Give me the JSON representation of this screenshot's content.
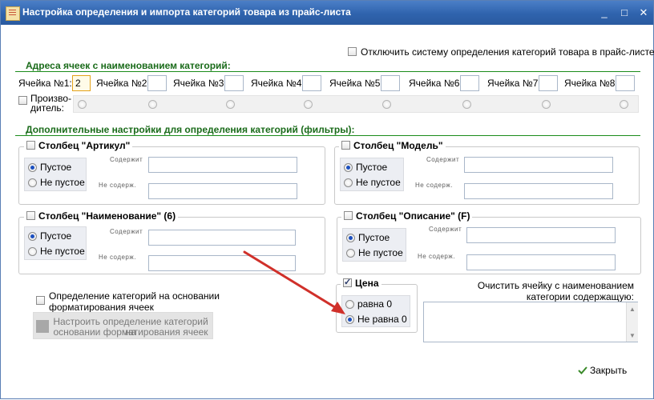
{
  "window": {
    "title": "Настройка определения и импорта категорий товара из прайс-листа",
    "minimize_label": "_",
    "maximize_label": "□",
    "close_label": "✕"
  },
  "top_option": {
    "label": "Отключить систему определения категорий товара в прайс-листе",
    "checked": false
  },
  "cells_section": {
    "title": "Адреса ячеек с наименованием категорий:",
    "cells": [
      {
        "label": "Ячейка №1:",
        "value": "2"
      },
      {
        "label": "Ячейка №2:",
        "value": ""
      },
      {
        "label": "Ячейка №3:",
        "value": ""
      },
      {
        "label": "Ячейка №4:",
        "value": ""
      },
      {
        "label": "Ячейка №5:",
        "value": ""
      },
      {
        "label": "Ячейка №6:",
        "value": ""
      },
      {
        "label": "Ячейка №7:",
        "value": ""
      },
      {
        "label": "Ячейка №8:",
        "value": ""
      }
    ],
    "producer_line1": "Произво-",
    "producer_line2": "дитель:"
  },
  "filters_section": {
    "title": "Дополнительные настройки для определения категорий (фильтры):",
    "contains_label": "Содержит",
    "not_contains_label": "Не содерж.",
    "columns": [
      {
        "title": "Столбец \"Артикул\"",
        "checked": false,
        "opt_empty": "Пустое",
        "opt_not_empty": "Не пустое",
        "selected": "empty"
      },
      {
        "title": "Столбец \"Модель\"",
        "checked": false,
        "opt_empty": "Пустое",
        "opt_not_empty": "Не пустое",
        "selected": "empty"
      },
      {
        "title": "Столбец \"Наименование\" (6)",
        "checked": false,
        "opt_empty": "Пустое",
        "opt_not_empty": "Не пустое",
        "selected": "empty"
      },
      {
        "title": "Столбец \"Описание\" (F)",
        "checked": false,
        "opt_empty": "Пустое",
        "opt_not_empty": "Не пустое",
        "selected": "empty"
      }
    ]
  },
  "formatting": {
    "line1": "Определение категорий на основании",
    "line2": "форматирования ячеек",
    "checked": false,
    "button_line1": "Настроить определение категорий на",
    "button_line2": "основании форматирования ячеек"
  },
  "price": {
    "title": "Цена",
    "checked": true,
    "opt_zero": "равна 0",
    "opt_nonzero": "Не равна 0",
    "selected": "nonzero"
  },
  "clear_cell": {
    "line1": "Очистить ячейку с наименованием",
    "line2": "категории содержащую:",
    "value": ""
  },
  "close_button": {
    "label": "Закрыть"
  },
  "colors": {
    "title_bar": "#2f63ad",
    "section_green": "#1a6b1a",
    "arrow_red": "#d0302a"
  }
}
